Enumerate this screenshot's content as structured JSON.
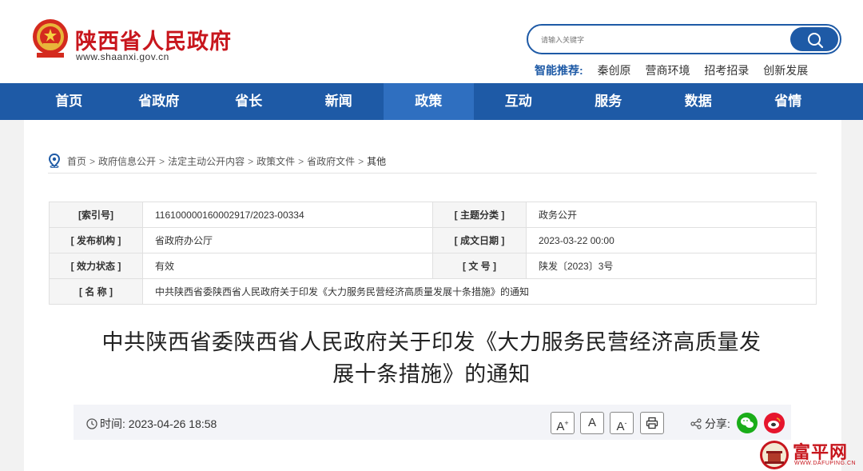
{
  "header": {
    "site_title": "陕西省人民政府",
    "site_url": "www.shaanxi.gov.cn",
    "search_placeholder": "请输入关键字",
    "recommend_label": "智能推荐:",
    "recommend_items": [
      "秦创原",
      "营商环境",
      "招考招录",
      "创新发展"
    ]
  },
  "nav": {
    "items": [
      "首页",
      "省政府",
      "省长",
      "新闻",
      "政策",
      "互动",
      "服务",
      "数据",
      "省情"
    ],
    "active": "政策"
  },
  "breadcrumb": {
    "items": [
      "首页",
      "政府信息公开",
      "法定主动公开内容",
      "政策文件",
      "省政府文件"
    ],
    "current": "其他",
    "separator": ">"
  },
  "info": {
    "index_label": "[索引号]",
    "index_value": "116100000160002917/2023-00334",
    "topic_label": "[ 主题分类 ]",
    "topic_value": "政务公开",
    "issuer_label": "[ 发布机构 ]",
    "issuer_value": "省政府办公厅",
    "date_label": "[ 成文日期 ]",
    "date_value": "2023-03-22 00:00",
    "status_label": "[ 效力状态 ]",
    "status_value": "有效",
    "docno_label": "[ 文 号 ]",
    "docno_value": "陕发〔2023〕3号",
    "name_label": "[ 名 称 ]",
    "name_value": "中共陕西省委陕西省人民政府关于印发《大力服务民营经济高质量发展十条措施》的通知"
  },
  "article": {
    "title_line1": "中共陕西省委陕西省人民政府关于印发《大力服务民营经济高质量发",
    "title_line2": "展十条措施》的通知",
    "time_label": "时间:",
    "time_value": "2023-04-26 18:58",
    "font_large": "A",
    "font_normal": "A",
    "font_small": "A",
    "share_label": "分享:"
  },
  "watermark": {
    "text": "富平网",
    "sub": "WWW.DAFUPING.CN"
  },
  "colors": {
    "brand_blue": "#1e5aa6",
    "brand_red": "#c8161d",
    "nav_active": "#2f6fc0"
  }
}
